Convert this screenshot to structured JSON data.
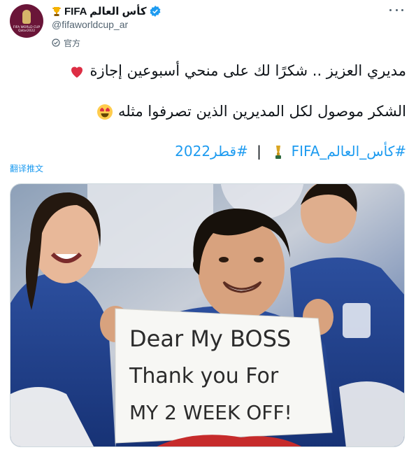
{
  "account": {
    "display_name": "FIFA كأس العالم",
    "handle": "@fifaworldcup_ar",
    "label": "官方",
    "avatar_text": "FIFA WORLD CUP Qatar2022"
  },
  "tweet": {
    "line1": "مديري العزيز .. شكرًا لك على منحي أسبوعين إجازة",
    "line2": "الشكر موصول لكل المديرين الذين تصرفوا مثله",
    "hashtag1": "#كأس_العالم_FIFA",
    "separator": "|",
    "hashtag2": "#قطر2022",
    "translate_label": "翻译推文"
  },
  "photo": {
    "sign_line1": "Dear My BOSS",
    "sign_line2": "Thank you For",
    "sign_line3": "MY 2 WEEK OFF!"
  },
  "colors": {
    "link": "#1d9bf0",
    "secondary": "#536471",
    "verified": "#1d9bf0",
    "avatar_bg": "#6a1538"
  },
  "icons": [
    "trophy-icon",
    "verified-badge-icon",
    "official-icon",
    "more-icon",
    "heart-icon",
    "heart-eyes-icon",
    "world-cup-trophy-icon"
  ]
}
